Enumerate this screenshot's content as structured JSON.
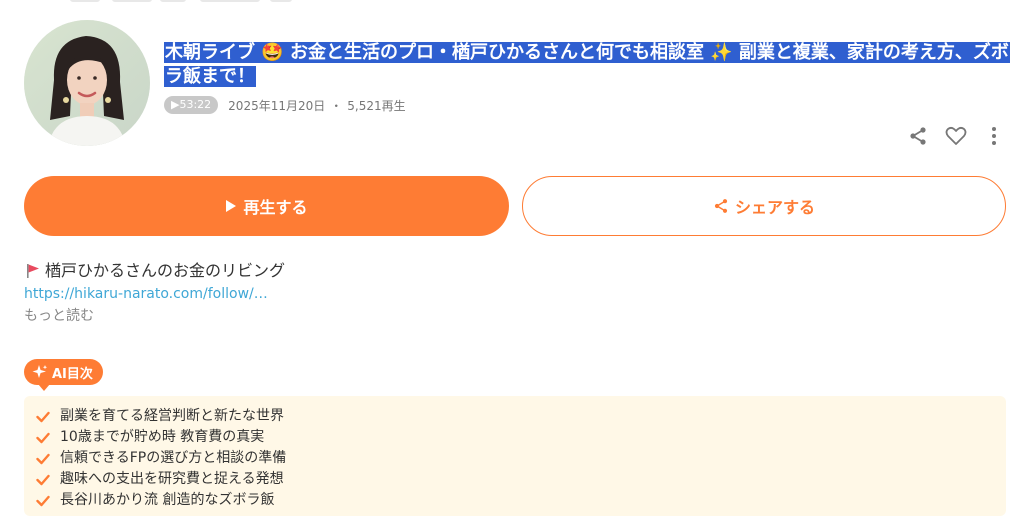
{
  "episode": {
    "title": "木朝ライブ 🤩 お金と生活のプロ・楢戸ひかるさんと何でも相談室 ✨ 副業と複業、家計の考え方、ズボラ飯まで！",
    "duration": "▶53:22",
    "date": "2025年11月20日",
    "separator": "・",
    "plays": "5,521再生"
  },
  "icons": {
    "share": "share-icon",
    "like": "heart-icon",
    "more": "more-vertical-icon",
    "flag": "flag-icon"
  },
  "buttons": {
    "play_label": "再生する",
    "share_label": "シェアする"
  },
  "description": {
    "channel_line": "楢戸ひかるさんのお金のリビング",
    "link_text": "https://hikaru-narato.com/follow/…",
    "read_more": "もっと読む"
  },
  "ai_toc": {
    "badge": "AI目次",
    "items": [
      "副業を育てる経営判断と新たな世界",
      "10歳までが貯め時 教育費の真実",
      "信頼できるFPの選び方と相談の準備",
      "趣味への支出を研究費と捉える発想",
      "長谷川あかり流 創造的なズボラ飯"
    ]
  },
  "colors": {
    "accent": "#fe7c34",
    "link": "#3fa7d6",
    "selection": "#2f5fd0",
    "toc_bg": "#fff8e7"
  }
}
